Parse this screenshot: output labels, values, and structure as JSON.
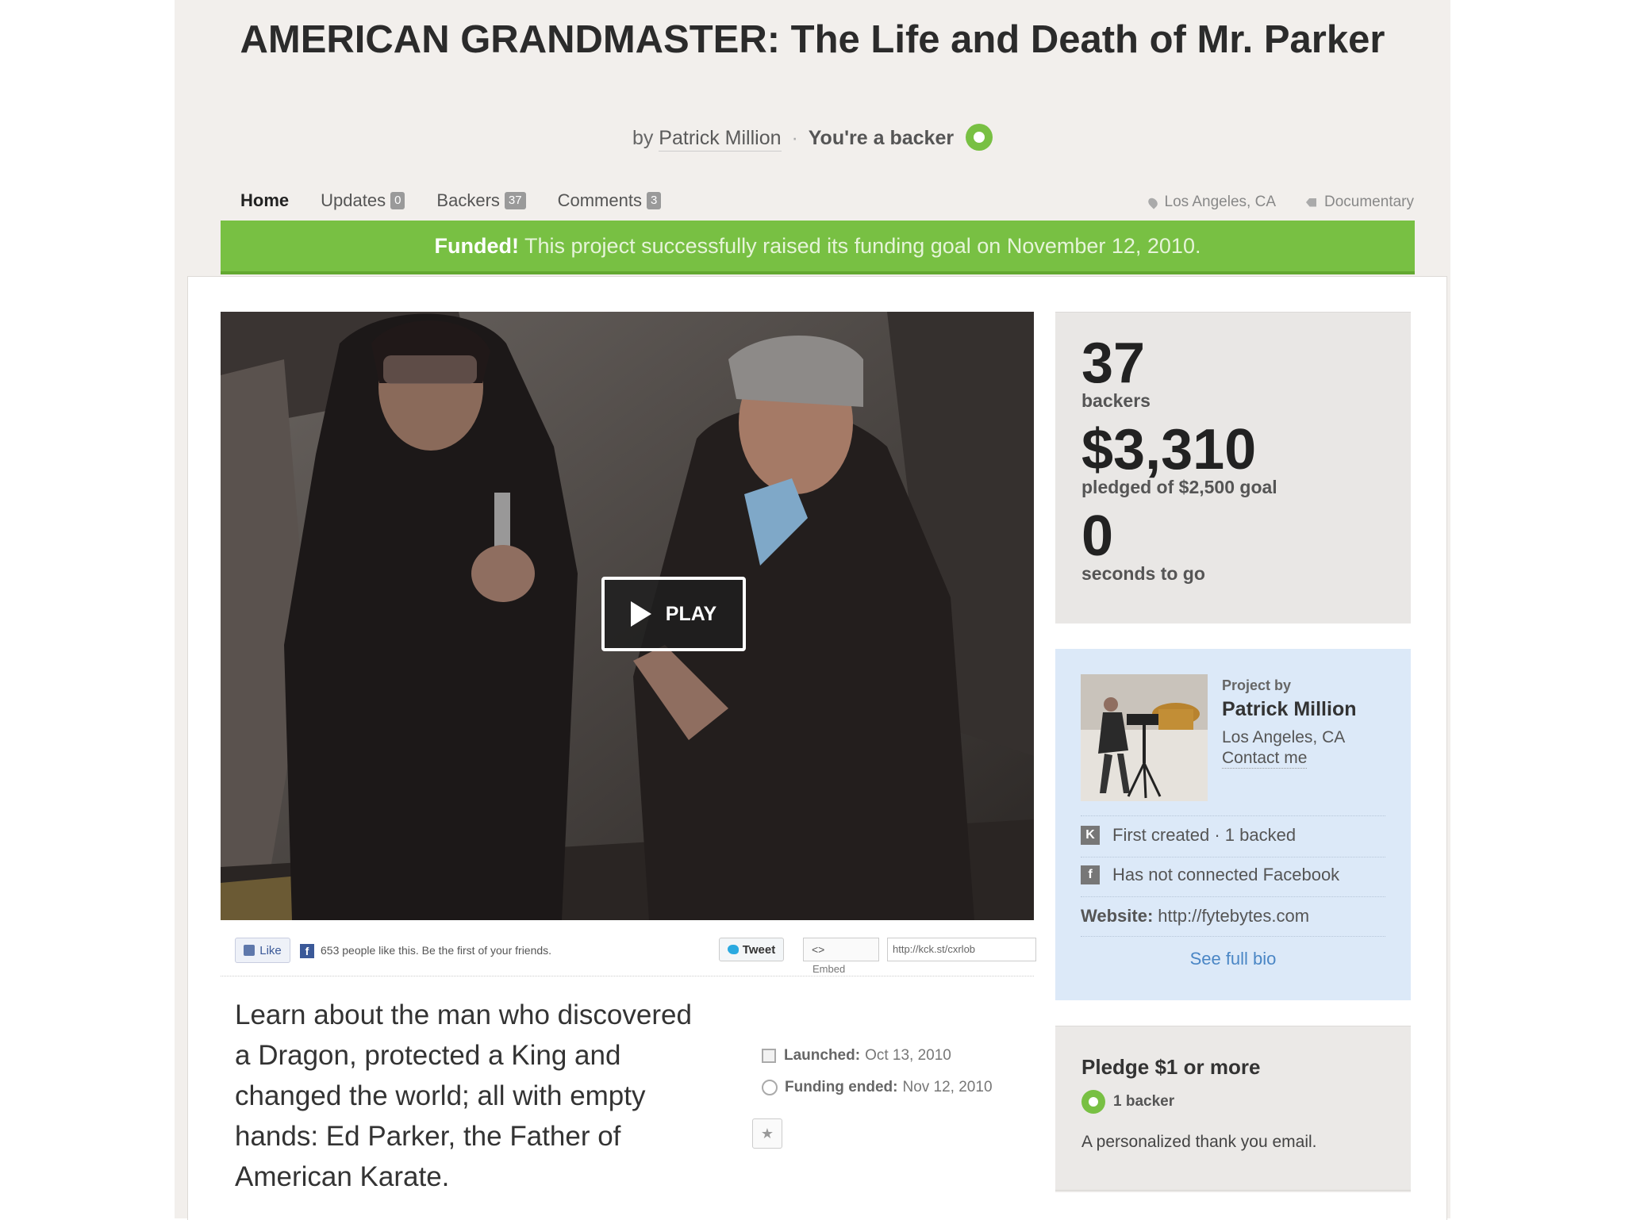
{
  "project": {
    "title": "AMERICAN GRANDMASTER: The Life and Death of Mr. Parker",
    "by_label": "by",
    "author": "Patrick Million",
    "backer_status": "You're a backer"
  },
  "nav": {
    "home": "Home",
    "updates": "Updates",
    "updates_count": "0",
    "backers": "Backers",
    "backers_count": "37",
    "comments": "Comments",
    "comments_count": "3",
    "location": "Los Angeles, CA",
    "category": "Documentary"
  },
  "banner": {
    "funded": "Funded!",
    "message": "This project successfully raised its funding goal on November 12, 2010."
  },
  "video": {
    "play_label": "PLAY"
  },
  "share": {
    "like_label": "Like",
    "likes_text": "653 people like this. Be the first of your friends.",
    "tweet_label": "Tweet",
    "embed_code": "<>",
    "embed_label": "Embed",
    "short_url": "http://kck.st/cxrlob"
  },
  "blurb": "Learn about the man who discovered a Dragon, protected a King and changed the world; all with empty hands: Ed Parker, the Father of American Karate.",
  "dates": {
    "launched_label": "Launched:",
    "launched": "Oct 13, 2010",
    "ended_label": "Funding ended:",
    "ended": "Nov 12, 2010"
  },
  "stats": {
    "backers_num": "37",
    "backers_label": "backers",
    "pledged_num": "$3,310",
    "pledged_label": "pledged of $2,500 goal",
    "time_num": "0",
    "time_label": "seconds to go"
  },
  "creator": {
    "project_by": "Project by",
    "name": "Patrick Million",
    "location": "Los Angeles, CA",
    "contact": "Contact me",
    "history": "First created · 1 backed",
    "facebook": "Has not connected Facebook",
    "website_label": "Website:",
    "website": "http://fytebytes.com",
    "bio_link": "See full bio"
  },
  "reward": {
    "title": "Pledge $1 or more",
    "backers": "1 backer",
    "description": "A personalized thank you email."
  },
  "colors": {
    "funded_green": "#78c043",
    "link_blue": "#4a86c5",
    "creator_bg": "#dce9f8"
  }
}
